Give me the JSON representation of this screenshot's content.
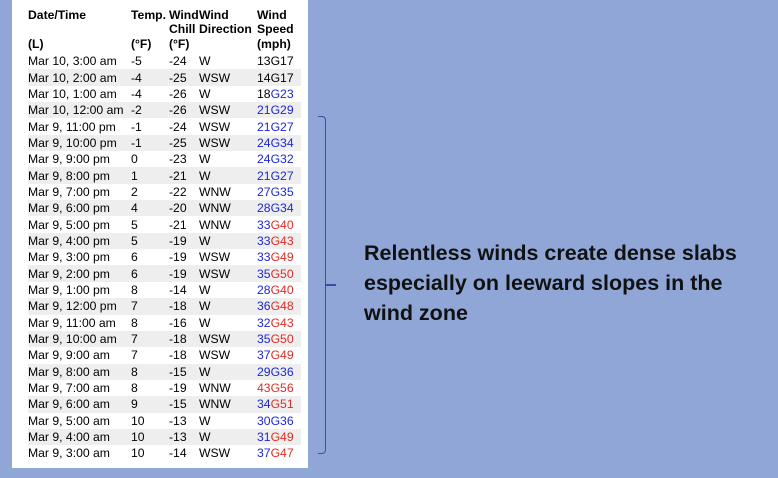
{
  "table": {
    "headers": {
      "datetime": "Date/Time",
      "temp": "Temp.",
      "wind_chill": "Wind Chill",
      "wind_direction": "Wind Direction",
      "wind_speed": "Wind Speed"
    },
    "units": {
      "datetime": "(L)",
      "temp": "(°F)",
      "wind_chill": "(°F)",
      "wind_direction": "",
      "wind_speed": "(mph)"
    },
    "rows": [
      {
        "datetime": "Mar 10, 3:00 am",
        "temp": "-5",
        "chill": "-24",
        "dir": "W",
        "speed": "13",
        "gust": "17",
        "speed_color": "#000000",
        "gust_color": "#000000"
      },
      {
        "datetime": "Mar 10, 2:00 am",
        "temp": "-4",
        "chill": "-25",
        "dir": "WSW",
        "speed": "14",
        "gust": "17",
        "speed_color": "#000000",
        "gust_color": "#000000"
      },
      {
        "datetime": "Mar 10, 1:00 am",
        "temp": "-4",
        "chill": "-26",
        "dir": "W",
        "speed": "18",
        "gust": "23",
        "speed_color": "#000000",
        "gust_color": "#1c27d8"
      },
      {
        "datetime": "Mar 10, 12:00 am",
        "temp": "-2",
        "chill": "-26",
        "dir": "WSW",
        "speed": "21",
        "gust": "29",
        "speed_color": "#1c27d8",
        "gust_color": "#1c27d8"
      },
      {
        "datetime": "Mar 9, 11:00 pm",
        "temp": "-1",
        "chill": "-24",
        "dir": "WSW",
        "speed": "21",
        "gust": "27",
        "speed_color": "#1c27d8",
        "gust_color": "#1c27d8"
      },
      {
        "datetime": "Mar 9, 10:00 pm",
        "temp": "-1",
        "chill": "-25",
        "dir": "WSW",
        "speed": "24",
        "gust": "34",
        "speed_color": "#1c27d8",
        "gust_color": "#1c27d8"
      },
      {
        "datetime": "Mar 9, 9:00 pm",
        "temp": "0",
        "chill": "-23",
        "dir": "W",
        "speed": "24",
        "gust": "32",
        "speed_color": "#1c27d8",
        "gust_color": "#1c27d8"
      },
      {
        "datetime": "Mar 9, 8:00 pm",
        "temp": "1",
        "chill": "-21",
        "dir": "W",
        "speed": "21",
        "gust": "27",
        "speed_color": "#1c27d8",
        "gust_color": "#1c27d8"
      },
      {
        "datetime": "Mar 9, 7:00 pm",
        "temp": "2",
        "chill": "-22",
        "dir": "WNW",
        "speed": "27",
        "gust": "35",
        "speed_color": "#1c27d8",
        "gust_color": "#1c27d8"
      },
      {
        "datetime": "Mar 9, 6:00 pm",
        "temp": "4",
        "chill": "-20",
        "dir": "WNW",
        "speed": "28",
        "gust": "34",
        "speed_color": "#1c27d8",
        "gust_color": "#1c27d8"
      },
      {
        "datetime": "Mar 9, 5:00 pm",
        "temp": "5",
        "chill": "-21",
        "dir": "WNW",
        "speed": "33",
        "gust": "40",
        "speed_color": "#1c27d8",
        "gust_color": "#e32a22"
      },
      {
        "datetime": "Mar 9, 4:00 pm",
        "temp": "5",
        "chill": "-19",
        "dir": "W",
        "speed": "33",
        "gust": "43",
        "speed_color": "#1c27d8",
        "gust_color": "#e32a22"
      },
      {
        "datetime": "Mar 9, 3:00 pm",
        "temp": "6",
        "chill": "-19",
        "dir": "WSW",
        "speed": "33",
        "gust": "49",
        "speed_color": "#1c27d8",
        "gust_color": "#e32a22"
      },
      {
        "datetime": "Mar 9, 2:00 pm",
        "temp": "6",
        "chill": "-19",
        "dir": "WSW",
        "speed": "35",
        "gust": "50",
        "speed_color": "#1c27d8",
        "gust_color": "#e32a22"
      },
      {
        "datetime": "Mar 9, 1:00 pm",
        "temp": "8",
        "chill": "-14",
        "dir": "W",
        "speed": "28",
        "gust": "40",
        "speed_color": "#1c27d8",
        "gust_color": "#e32a22"
      },
      {
        "datetime": "Mar 9, 12:00 pm",
        "temp": "7",
        "chill": "-18",
        "dir": "W",
        "speed": "36",
        "gust": "48",
        "speed_color": "#1c27d8",
        "gust_color": "#e32a22"
      },
      {
        "datetime": "Mar 9, 11:00 am",
        "temp": "8",
        "chill": "-16",
        "dir": "W",
        "speed": "32",
        "gust": "43",
        "speed_color": "#1c27d8",
        "gust_color": "#e32a22"
      },
      {
        "datetime": "Mar 9, 10:00 am",
        "temp": "7",
        "chill": "-18",
        "dir": "WSW",
        "speed": "35",
        "gust": "50",
        "speed_color": "#1c27d8",
        "gust_color": "#e32a22"
      },
      {
        "datetime": "Mar 9, 9:00 am",
        "temp": "7",
        "chill": "-18",
        "dir": "WSW",
        "speed": "37",
        "gust": "49",
        "speed_color": "#1c27d8",
        "gust_color": "#e32a22"
      },
      {
        "datetime": "Mar 9, 8:00 am",
        "temp": "8",
        "chill": "-15",
        "dir": "W",
        "speed": "29",
        "gust": "36",
        "speed_color": "#1c27d8",
        "gust_color": "#1c27d8"
      },
      {
        "datetime": "Mar 9, 7:00 am",
        "temp": "8",
        "chill": "-19",
        "dir": "WNW",
        "speed": "43",
        "gust": "56",
        "speed_color": "#e32a22",
        "gust_color": "#e32a22"
      },
      {
        "datetime": "Mar 9, 6:00 am",
        "temp": "9",
        "chill": "-15",
        "dir": "WNW",
        "speed": "34",
        "gust": "51",
        "speed_color": "#1c27d8",
        "gust_color": "#e32a22"
      },
      {
        "datetime": "Mar 9, 5:00 am",
        "temp": "10",
        "chill": "-13",
        "dir": "W",
        "speed": "30",
        "gust": "36",
        "speed_color": "#1c27d8",
        "gust_color": "#1c27d8"
      },
      {
        "datetime": "Mar 9, 4:00 am",
        "temp": "10",
        "chill": "-13",
        "dir": "W",
        "speed": "31",
        "gust": "49",
        "speed_color": "#1c27d8",
        "gust_color": "#e32a22"
      },
      {
        "datetime": "Mar 9, 3:00 am",
        "temp": "10",
        "chill": "-14",
        "dir": "WSW",
        "speed": "37",
        "gust": "47",
        "speed_color": "#1c27d8",
        "gust_color": "#e32a22"
      }
    ]
  },
  "callout": {
    "text": "Relentless winds create dense slabs especially on leeward slopes in the wind zone"
  },
  "colors": {
    "background": "#8fa6d6",
    "blue_value": "#1c27d8",
    "red_value": "#e32a22",
    "bracket": "#3a4ea8"
  }
}
